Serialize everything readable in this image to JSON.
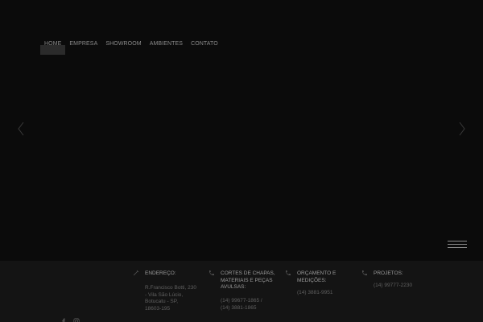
{
  "nav": {
    "items": [
      {
        "label": "HOME",
        "active": true
      },
      {
        "label": "EMPRESA",
        "active": false
      },
      {
        "label": "SHOWROOM",
        "active": false
      },
      {
        "label": "AMBIENTES",
        "active": false
      },
      {
        "label": "CONTATO",
        "active": false
      }
    ]
  },
  "slider": {
    "prev_icon": "chevron-left-icon",
    "next_icon": "chevron-right-icon"
  },
  "menu_icon": "hamburger-menu-icon",
  "footer": {
    "address": {
      "icon": "pin-icon",
      "label": "ENDEREÇO:",
      "lines": [
        "R.Francisco Botti, 230",
        " - Vila São Lúcio,",
        "Botucatu - SP,",
        "18603-195"
      ]
    },
    "cortes": {
      "icon": "phone-icon",
      "label_lines": [
        "CORTES DE CHAPAS,",
        "MATERIAIS E PEÇAS",
        "AVULSAS:"
      ],
      "value_lines": [
        "(14) 99677-1865 /",
        "(14) 3881-1865"
      ]
    },
    "orcamento": {
      "icon": "phone-icon",
      "label_lines": [
        "ORÇAMENTO E",
        "MEDIÇÕES:"
      ],
      "value_lines": [
        "(14) 3881-9951"
      ]
    },
    "projetos": {
      "icon": "phone-icon",
      "label_lines": [
        "PROJETOS:"
      ],
      "value_lines": [
        "(14) 99777-2230"
      ]
    }
  },
  "social": {
    "icons": [
      "facebook-icon",
      "instagram-icon"
    ]
  },
  "colors": {
    "background": "#0b0b0b",
    "footer_bg": "#141414",
    "nav_active_bg": "#2b2b2b",
    "text_muted": "#606060",
    "text_label": "#9a9a9a"
  }
}
